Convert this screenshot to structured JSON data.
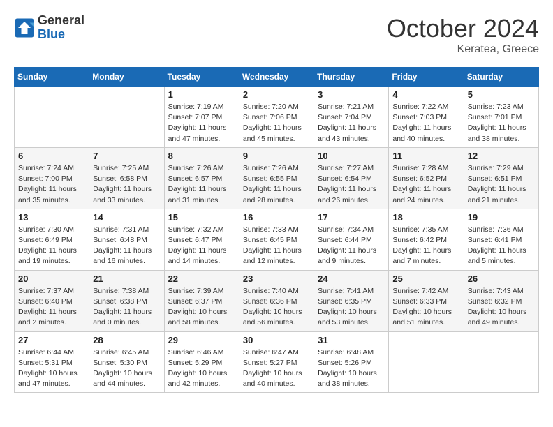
{
  "logo": {
    "general": "General",
    "blue": "Blue"
  },
  "header": {
    "month": "October 2024",
    "location": "Keratea, Greece"
  },
  "weekdays": [
    "Sunday",
    "Monday",
    "Tuesday",
    "Wednesday",
    "Thursday",
    "Friday",
    "Saturday"
  ],
  "weeks": [
    [
      {
        "day": "",
        "sunrise": "",
        "sunset": "",
        "daylight": ""
      },
      {
        "day": "",
        "sunrise": "",
        "sunset": "",
        "daylight": ""
      },
      {
        "day": "1",
        "sunrise": "Sunrise: 7:19 AM",
        "sunset": "Sunset: 7:07 PM",
        "daylight": "Daylight: 11 hours and 47 minutes."
      },
      {
        "day": "2",
        "sunrise": "Sunrise: 7:20 AM",
        "sunset": "Sunset: 7:06 PM",
        "daylight": "Daylight: 11 hours and 45 minutes."
      },
      {
        "day": "3",
        "sunrise": "Sunrise: 7:21 AM",
        "sunset": "Sunset: 7:04 PM",
        "daylight": "Daylight: 11 hours and 43 minutes."
      },
      {
        "day": "4",
        "sunrise": "Sunrise: 7:22 AM",
        "sunset": "Sunset: 7:03 PM",
        "daylight": "Daylight: 11 hours and 40 minutes."
      },
      {
        "day": "5",
        "sunrise": "Sunrise: 7:23 AM",
        "sunset": "Sunset: 7:01 PM",
        "daylight": "Daylight: 11 hours and 38 minutes."
      }
    ],
    [
      {
        "day": "6",
        "sunrise": "Sunrise: 7:24 AM",
        "sunset": "Sunset: 7:00 PM",
        "daylight": "Daylight: 11 hours and 35 minutes."
      },
      {
        "day": "7",
        "sunrise": "Sunrise: 7:25 AM",
        "sunset": "Sunset: 6:58 PM",
        "daylight": "Daylight: 11 hours and 33 minutes."
      },
      {
        "day": "8",
        "sunrise": "Sunrise: 7:26 AM",
        "sunset": "Sunset: 6:57 PM",
        "daylight": "Daylight: 11 hours and 31 minutes."
      },
      {
        "day": "9",
        "sunrise": "Sunrise: 7:26 AM",
        "sunset": "Sunset: 6:55 PM",
        "daylight": "Daylight: 11 hours and 28 minutes."
      },
      {
        "day": "10",
        "sunrise": "Sunrise: 7:27 AM",
        "sunset": "Sunset: 6:54 PM",
        "daylight": "Daylight: 11 hours and 26 minutes."
      },
      {
        "day": "11",
        "sunrise": "Sunrise: 7:28 AM",
        "sunset": "Sunset: 6:52 PM",
        "daylight": "Daylight: 11 hours and 24 minutes."
      },
      {
        "day": "12",
        "sunrise": "Sunrise: 7:29 AM",
        "sunset": "Sunset: 6:51 PM",
        "daylight": "Daylight: 11 hours and 21 minutes."
      }
    ],
    [
      {
        "day": "13",
        "sunrise": "Sunrise: 7:30 AM",
        "sunset": "Sunset: 6:49 PM",
        "daylight": "Daylight: 11 hours and 19 minutes."
      },
      {
        "day": "14",
        "sunrise": "Sunrise: 7:31 AM",
        "sunset": "Sunset: 6:48 PM",
        "daylight": "Daylight: 11 hours and 16 minutes."
      },
      {
        "day": "15",
        "sunrise": "Sunrise: 7:32 AM",
        "sunset": "Sunset: 6:47 PM",
        "daylight": "Daylight: 11 hours and 14 minutes."
      },
      {
        "day": "16",
        "sunrise": "Sunrise: 7:33 AM",
        "sunset": "Sunset: 6:45 PM",
        "daylight": "Daylight: 11 hours and 12 minutes."
      },
      {
        "day": "17",
        "sunrise": "Sunrise: 7:34 AM",
        "sunset": "Sunset: 6:44 PM",
        "daylight": "Daylight: 11 hours and 9 minutes."
      },
      {
        "day": "18",
        "sunrise": "Sunrise: 7:35 AM",
        "sunset": "Sunset: 6:42 PM",
        "daylight": "Daylight: 11 hours and 7 minutes."
      },
      {
        "day": "19",
        "sunrise": "Sunrise: 7:36 AM",
        "sunset": "Sunset: 6:41 PM",
        "daylight": "Daylight: 11 hours and 5 minutes."
      }
    ],
    [
      {
        "day": "20",
        "sunrise": "Sunrise: 7:37 AM",
        "sunset": "Sunset: 6:40 PM",
        "daylight": "Daylight: 11 hours and 2 minutes."
      },
      {
        "day": "21",
        "sunrise": "Sunrise: 7:38 AM",
        "sunset": "Sunset: 6:38 PM",
        "daylight": "Daylight: 11 hours and 0 minutes."
      },
      {
        "day": "22",
        "sunrise": "Sunrise: 7:39 AM",
        "sunset": "Sunset: 6:37 PM",
        "daylight": "Daylight: 10 hours and 58 minutes."
      },
      {
        "day": "23",
        "sunrise": "Sunrise: 7:40 AM",
        "sunset": "Sunset: 6:36 PM",
        "daylight": "Daylight: 10 hours and 56 minutes."
      },
      {
        "day": "24",
        "sunrise": "Sunrise: 7:41 AM",
        "sunset": "Sunset: 6:35 PM",
        "daylight": "Daylight: 10 hours and 53 minutes."
      },
      {
        "day": "25",
        "sunrise": "Sunrise: 7:42 AM",
        "sunset": "Sunset: 6:33 PM",
        "daylight": "Daylight: 10 hours and 51 minutes."
      },
      {
        "day": "26",
        "sunrise": "Sunrise: 7:43 AM",
        "sunset": "Sunset: 6:32 PM",
        "daylight": "Daylight: 10 hours and 49 minutes."
      }
    ],
    [
      {
        "day": "27",
        "sunrise": "Sunrise: 6:44 AM",
        "sunset": "Sunset: 5:31 PM",
        "daylight": "Daylight: 10 hours and 47 minutes."
      },
      {
        "day": "28",
        "sunrise": "Sunrise: 6:45 AM",
        "sunset": "Sunset: 5:30 PM",
        "daylight": "Daylight: 10 hours and 44 minutes."
      },
      {
        "day": "29",
        "sunrise": "Sunrise: 6:46 AM",
        "sunset": "Sunset: 5:29 PM",
        "daylight": "Daylight: 10 hours and 42 minutes."
      },
      {
        "day": "30",
        "sunrise": "Sunrise: 6:47 AM",
        "sunset": "Sunset: 5:27 PM",
        "daylight": "Daylight: 10 hours and 40 minutes."
      },
      {
        "day": "31",
        "sunrise": "Sunrise: 6:48 AM",
        "sunset": "Sunset: 5:26 PM",
        "daylight": "Daylight: 10 hours and 38 minutes."
      },
      {
        "day": "",
        "sunrise": "",
        "sunset": "",
        "daylight": ""
      },
      {
        "day": "",
        "sunrise": "",
        "sunset": "",
        "daylight": ""
      }
    ]
  ]
}
